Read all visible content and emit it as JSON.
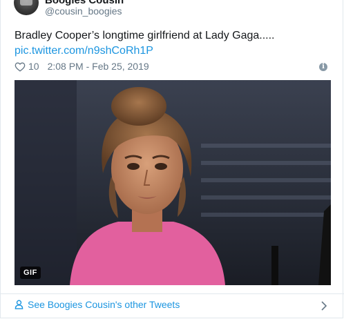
{
  "user": {
    "display_name": "Boogies Cousin",
    "handle": "@cousin_boogies"
  },
  "tweet": {
    "text": "Bradley Cooper’s longtime girlfriend at Lady Gaga.....",
    "link": "pic.twitter.com/n9shCoRh1P",
    "like_count": "10",
    "timestamp": "2:08 PM - Feb 25, 2019"
  },
  "media": {
    "badge": "GIF"
  },
  "footer": {
    "profile_link": "See Boogies Cousin's other Tweets"
  },
  "colors": {
    "link": "#1b95e0",
    "secondary_text": "#657786",
    "border": "#e1e8ed"
  }
}
